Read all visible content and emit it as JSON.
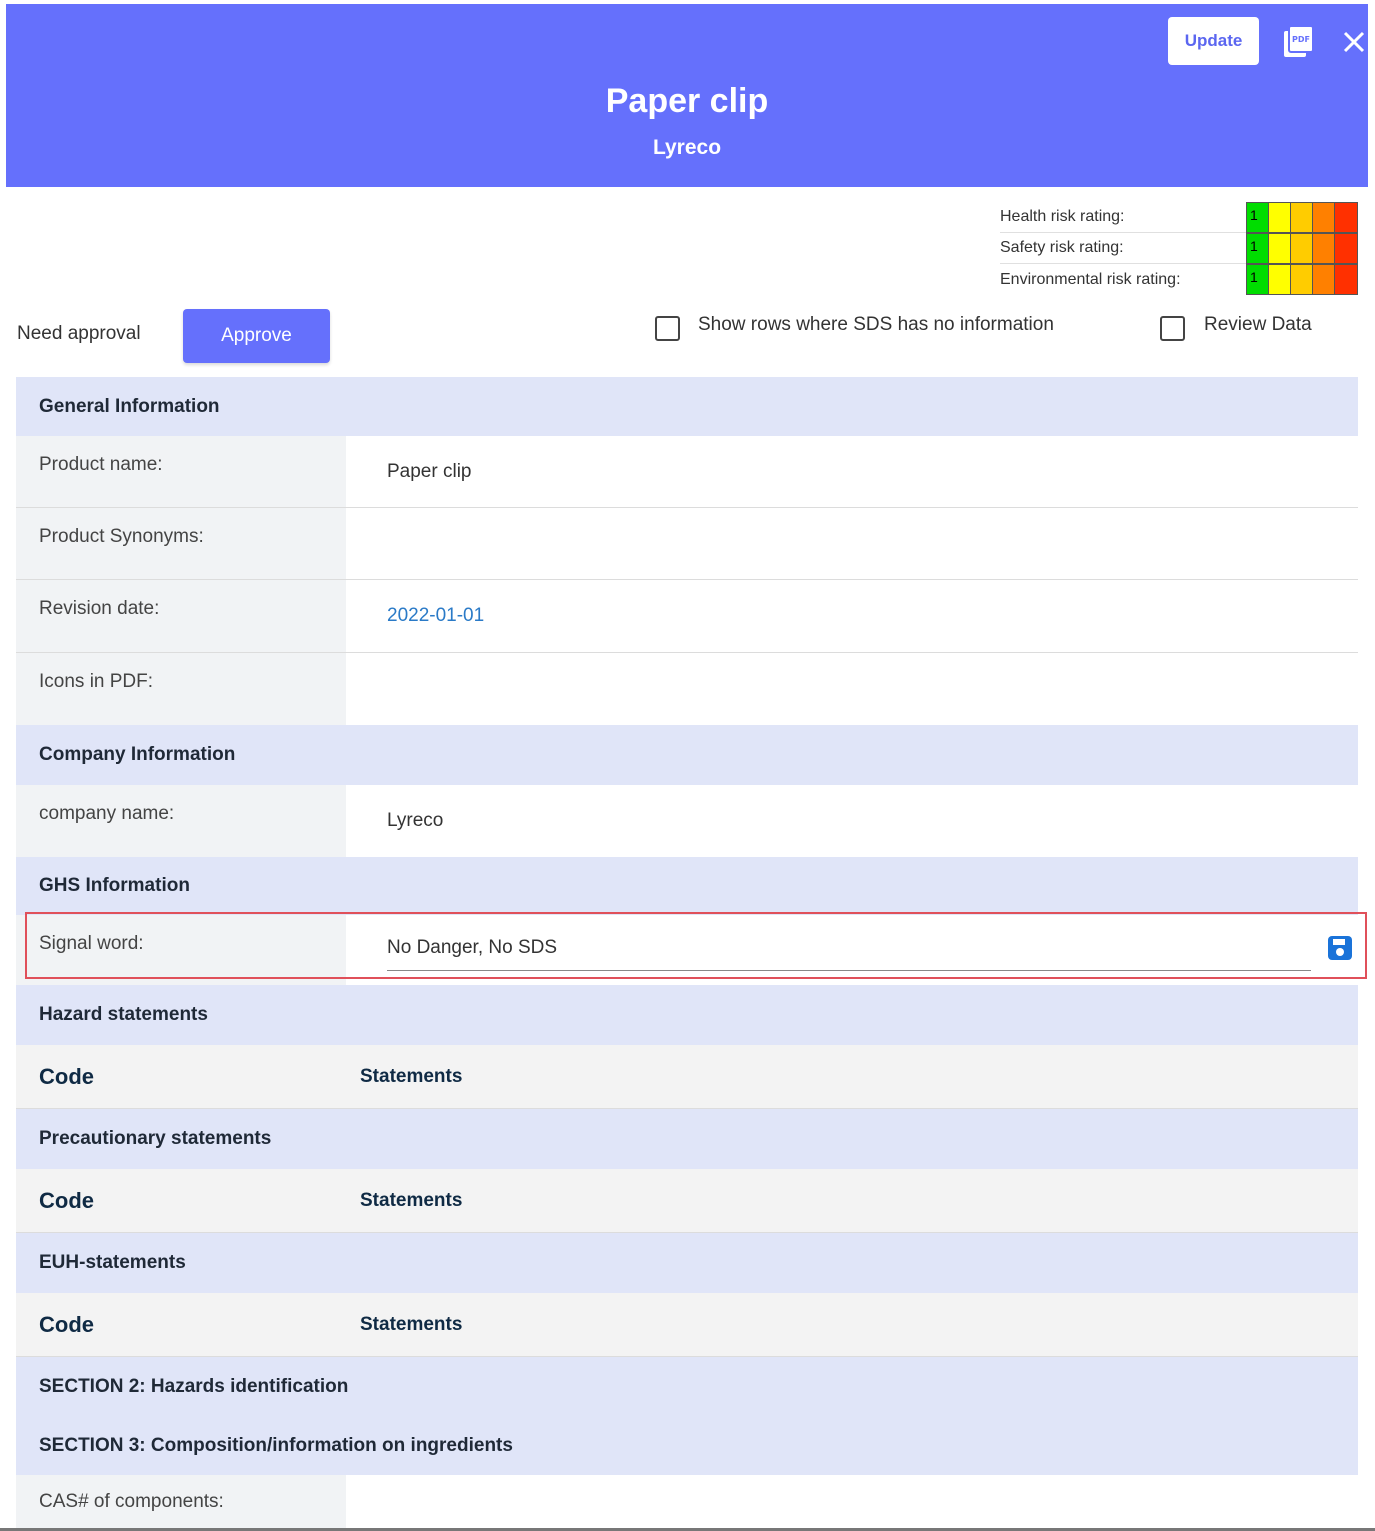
{
  "header": {
    "title": "Paper clip",
    "subtitle": "Lyreco",
    "update_label": "Update",
    "pdf_icon": "pdf-icon",
    "close_icon": "close-icon",
    "background": "#6570fc"
  },
  "risk": {
    "rows": [
      {
        "label": "Health risk rating:",
        "value": "1"
      },
      {
        "label": "Safety risk rating:",
        "value": "1"
      },
      {
        "label": "Environmental risk rating:",
        "value": "1"
      }
    ],
    "scale_colors": [
      "#00dd00",
      "#ffff00",
      "#ffcc00",
      "#ff8000",
      "#ff3000"
    ]
  },
  "approval": {
    "label": "Need approval",
    "button": "Approve"
  },
  "filters": {
    "show_empty_label": "Show rows where SDS has no information",
    "review_label": "Review Data"
  },
  "sections": {
    "general": "General Information",
    "product_name_label": "Product name:",
    "product_name_value": "Paper clip",
    "synonyms_label": "Product Synonyms:",
    "revision_label": "Revision date:",
    "revision_value": "2022-01-01",
    "icons_label": "Icons in PDF:",
    "company": "Company Information",
    "company_name_label": "company name:",
    "company_name_value": "Lyreco",
    "ghs": "GHS Information",
    "signal_label": "Signal word:",
    "signal_value": "No Danger, No SDS",
    "hazard": "Hazard statements",
    "precautionary": "Precautionary statements",
    "euh": "EUH-statements",
    "code_header": "Code",
    "statements_header": "Statements",
    "section2": "SECTION 2: Hazards identification",
    "section3": "SECTION 3: Composition/information on ingredients",
    "cas_label": "CAS# of components:"
  }
}
